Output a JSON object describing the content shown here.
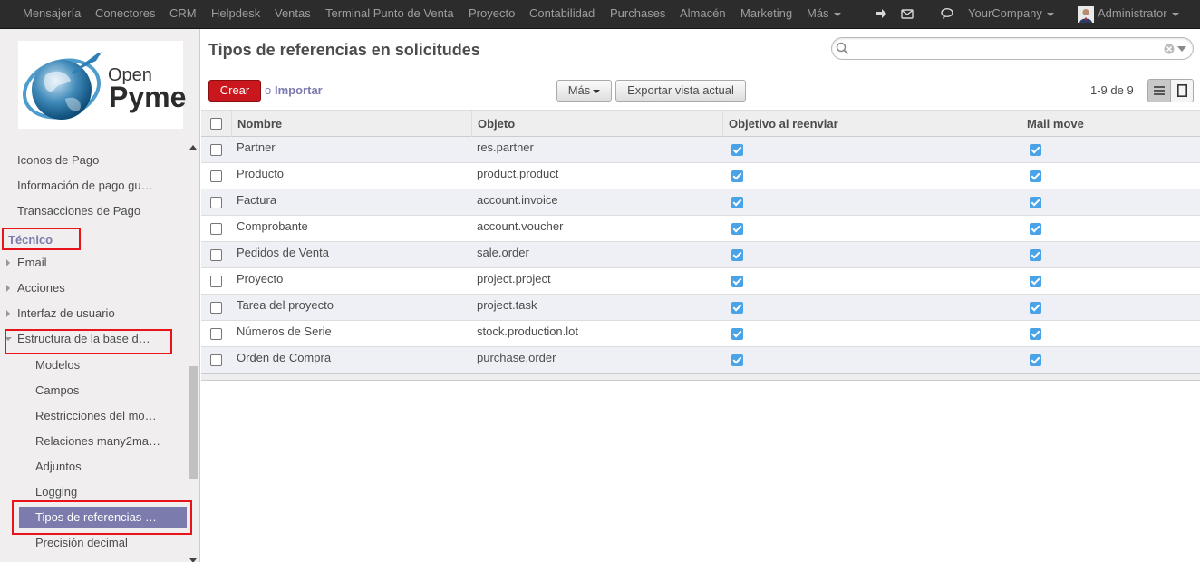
{
  "topbar": {
    "menu": [
      "Mensajería",
      "Conectores",
      "CRM",
      "Helpdesk",
      "Ventas",
      "Terminal Punto de Venta",
      "Proyecto",
      "Contabilidad",
      "Purchases",
      "Almacén",
      "Marketing"
    ],
    "more_label": "Más",
    "company": "YourCompany",
    "user": "Administrator",
    "icons": [
      "sign-in-icon",
      "mail-icon",
      "chat-icon"
    ]
  },
  "sidebar": {
    "logo": {
      "line1": "Open",
      "line2": "Pyme"
    },
    "items_top": [
      "Iconos de Pago",
      "Información de pago gu…",
      "Transacciones de Pago"
    ],
    "section_header": "Técnico",
    "items_tech": [
      "Email",
      "Acciones",
      "Interfaz de usuario",
      "Estructura de la base de…"
    ],
    "items_sub": [
      "Modelos",
      "Campos",
      "Restricciones del mo…",
      "Relaciones many2ma…",
      "Adjuntos",
      "Logging"
    ],
    "active_item": "Tipos de referencias …",
    "items_after": [
      "Precisión decimal"
    ]
  },
  "main": {
    "title": "Tipos de referencias en solicitudes",
    "search_placeholder": "",
    "create_label": "Crear",
    "or_label": "o",
    "import_label": "Importar",
    "more_label": "Más",
    "export_label": "Exportar vista actual",
    "pager": "1-9 de 9"
  },
  "table": {
    "columns": [
      "Nombre",
      "Objeto",
      "Objetivo al reenviar",
      "Mail move"
    ],
    "rows": [
      {
        "name": "Partner",
        "object": "res.partner",
        "target": true,
        "move": true
      },
      {
        "name": "Producto",
        "object": "product.product",
        "target": true,
        "move": true
      },
      {
        "name": "Factura",
        "object": "account.invoice",
        "target": true,
        "move": true
      },
      {
        "name": "Comprobante",
        "object": "account.voucher",
        "target": true,
        "move": true
      },
      {
        "name": "Pedidos de Venta",
        "object": "sale.order",
        "target": true,
        "move": true
      },
      {
        "name": "Proyecto",
        "object": "project.project",
        "target": true,
        "move": true
      },
      {
        "name": "Tarea del proyecto",
        "object": "project.task",
        "target": true,
        "move": true
      },
      {
        "name": "Números de Serie",
        "object": "stock.production.lot",
        "target": true,
        "move": true
      },
      {
        "name": "Orden de Compra",
        "object": "purchase.order",
        "target": true,
        "move": true
      }
    ]
  },
  "colors": {
    "topbar_bg": "#2c2c2c",
    "accent": "#7c7bad",
    "primary_button": "#c9171d",
    "highlight_box": "#e8141a",
    "checkbox_checked": "#4aa3e6"
  }
}
